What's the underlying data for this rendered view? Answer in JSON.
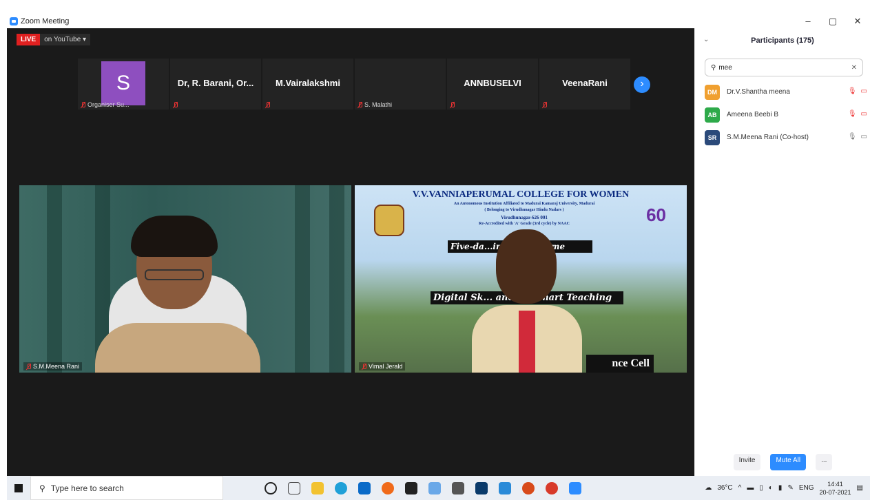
{
  "window": {
    "title": "Zoom Meeting",
    "min": "–",
    "restore": "▢",
    "close": "✕"
  },
  "live": {
    "tag": "LIVE",
    "platform": "on YouTube ▾"
  },
  "thumbs": [
    {
      "name": "",
      "foot": "Organiser Su...",
      "avatar": "S"
    },
    {
      "name": "Dr, R. Barani, Or...",
      "foot": ""
    },
    {
      "name": "M.Vairalakshmi",
      "foot": ""
    },
    {
      "name": "",
      "foot": "S. Malathi"
    },
    {
      "name": "ANNBUSELVI",
      "foot": ""
    },
    {
      "name": "VeenaRani",
      "foot": ""
    }
  ],
  "next_icon": "chevron-right-icon",
  "tiles": {
    "left_name": "S.M.Meena Rani",
    "right_name": "Vimal Jerald"
  },
  "college": {
    "title": "V.V.VANNIAPERUMAL COLLEGE FOR WOMEN",
    "line1": "An Autonomous Institution Affiliated to Madurai Kamaraj University, Madurai",
    "line2": "( Belonging to Virudhunagar Hindu Nadars )",
    "line3": "Virudhunagar-626 001",
    "line4": "Re-Accredited with 'A' Grade (3rd cycle) by NAAC",
    "banner1": "Five-da...ing Programme",
    "banner2": "Digital Sk... ancing Smart Teaching",
    "cell": "nce Cell",
    "logo": "60"
  },
  "participants": {
    "title": "Participants (175)",
    "search_value": "mee",
    "list": [
      {
        "initials": "DM",
        "name": "Dr.V.Shantha meena",
        "color": "#f0a030",
        "muted": true
      },
      {
        "initials": "AB",
        "name": "Ameena Beebi B",
        "color": "#2eaa4a",
        "muted": true
      },
      {
        "initials": "SR",
        "name": "S.M.Meena Rani (Co-host)",
        "color": "#2b4a7a",
        "muted": false
      }
    ],
    "invite": "Invite",
    "mute_all": "Mute All",
    "more": "..."
  },
  "taskbar": {
    "search_placeholder": "Type here to search",
    "temp": "36°C",
    "lang": "ENG",
    "time": "14:41",
    "date": "20-07-2021"
  }
}
